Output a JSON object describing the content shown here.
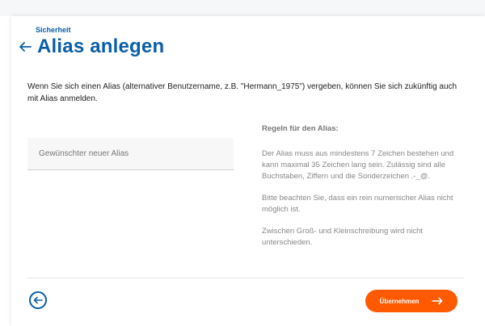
{
  "header": {
    "eyebrow": "Sicherheit",
    "title": "Alias anlegen",
    "back_icon": "arrow-left-icon"
  },
  "intro": {
    "text": "Wenn Sie sich einen Alias (alternativer Benutzername, z.B. \"Hermann_1975\") vergeben, können Sie sich zukünftig auch mit Alias anmelden."
  },
  "form": {
    "alias_placeholder": "Gewünschter neuer Alias",
    "alias_value": ""
  },
  "rules": {
    "heading": "Regeln für den Alias:",
    "items": [
      "Der Alias muss aus mindestens 7 Zeichen bestehen und kann maximal 35 Zeichen lang sein. Zulässig sind alle Buchstaben, Ziffern und die Sonderzeichen .-_@.",
      "Bitte beachten Sie, dass ein rein numerischer Alias nicht möglich ist.",
      "Zwischen Groß- und Kleinschreibung wird nicht unterschieden."
    ]
  },
  "footer": {
    "back_icon": "circle-arrow-left-icon",
    "submit_label": "Übernehmen",
    "submit_icon": "arrow-right-icon"
  },
  "colors": {
    "brand_blue": "#0a5ea8",
    "accent_orange": "#ff5a00"
  }
}
